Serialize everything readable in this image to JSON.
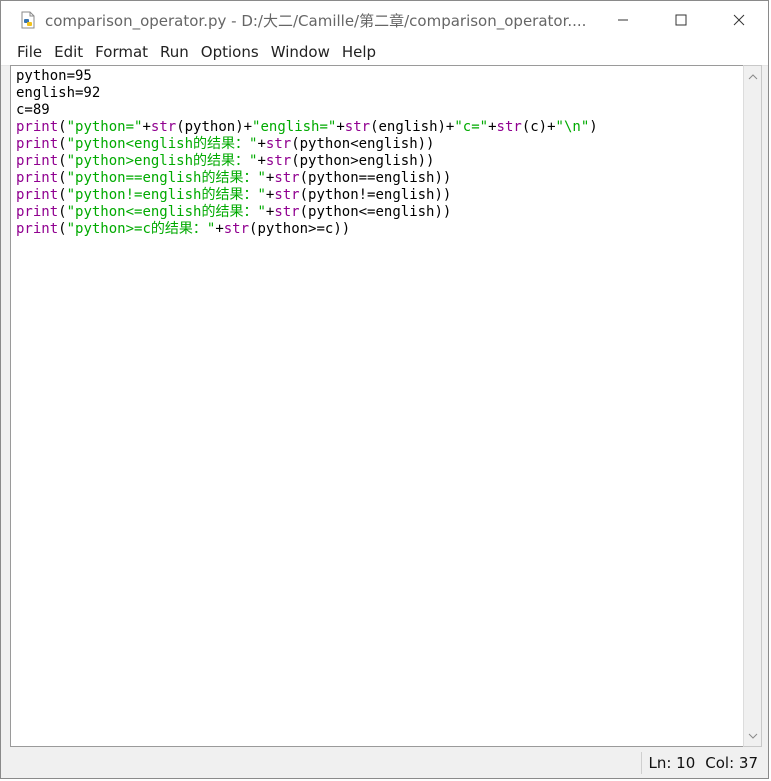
{
  "window": {
    "title": "comparison_operator.py - D:/大二/Camille/第二章/comparison_operator...."
  },
  "menu": {
    "items": [
      "File",
      "Edit",
      "Format",
      "Run",
      "Options",
      "Window",
      "Help"
    ]
  },
  "editor": {
    "lines": [
      [
        {
          "t": "python=95",
          "c": "plain"
        }
      ],
      [
        {
          "t": "english=92",
          "c": "plain"
        }
      ],
      [
        {
          "t": "c=89",
          "c": "plain"
        }
      ],
      [
        {
          "t": "print",
          "c": "kw"
        },
        {
          "t": "(",
          "c": "plain"
        },
        {
          "t": "\"python=\"",
          "c": "str"
        },
        {
          "t": "+",
          "c": "plain"
        },
        {
          "t": "str",
          "c": "kw"
        },
        {
          "t": "(python)+",
          "c": "plain"
        },
        {
          "t": "\"english=\"",
          "c": "str"
        },
        {
          "t": "+",
          "c": "plain"
        },
        {
          "t": "str",
          "c": "kw"
        },
        {
          "t": "(english)+",
          "c": "plain"
        },
        {
          "t": "\"c=\"",
          "c": "str"
        },
        {
          "t": "+",
          "c": "plain"
        },
        {
          "t": "str",
          "c": "kw"
        },
        {
          "t": "(c)+",
          "c": "plain"
        },
        {
          "t": "\"\\n\"",
          "c": "str"
        },
        {
          "t": ")",
          "c": "plain"
        }
      ],
      [
        {
          "t": "print",
          "c": "kw"
        },
        {
          "t": "(",
          "c": "plain"
        },
        {
          "t": "\"python<english的结果：\"",
          "c": "str"
        },
        {
          "t": "+",
          "c": "plain"
        },
        {
          "t": "str",
          "c": "kw"
        },
        {
          "t": "(python<english))",
          "c": "plain"
        }
      ],
      [
        {
          "t": "print",
          "c": "kw"
        },
        {
          "t": "(",
          "c": "plain"
        },
        {
          "t": "\"python>english的结果：\"",
          "c": "str"
        },
        {
          "t": "+",
          "c": "plain"
        },
        {
          "t": "str",
          "c": "kw"
        },
        {
          "t": "(python>english))",
          "c": "plain"
        }
      ],
      [
        {
          "t": "print",
          "c": "kw"
        },
        {
          "t": "(",
          "c": "plain"
        },
        {
          "t": "\"python==english的结果：\"",
          "c": "str"
        },
        {
          "t": "+",
          "c": "plain"
        },
        {
          "t": "str",
          "c": "kw"
        },
        {
          "t": "(python==english))",
          "c": "plain"
        }
      ],
      [
        {
          "t": "print",
          "c": "kw"
        },
        {
          "t": "(",
          "c": "plain"
        },
        {
          "t": "\"python!=english的结果：\"",
          "c": "str"
        },
        {
          "t": "+",
          "c": "plain"
        },
        {
          "t": "str",
          "c": "kw"
        },
        {
          "t": "(python!=english))",
          "c": "plain"
        }
      ],
      [
        {
          "t": "print",
          "c": "kw"
        },
        {
          "t": "(",
          "c": "plain"
        },
        {
          "t": "\"python<=english的结果：\"",
          "c": "str"
        },
        {
          "t": "+",
          "c": "plain"
        },
        {
          "t": "str",
          "c": "kw"
        },
        {
          "t": "(python<=english))",
          "c": "plain"
        }
      ],
      [
        {
          "t": "print",
          "c": "kw"
        },
        {
          "t": "(",
          "c": "plain"
        },
        {
          "t": "\"python>=c的结果：\"",
          "c": "str"
        },
        {
          "t": "+",
          "c": "plain"
        },
        {
          "t": "str",
          "c": "kw"
        },
        {
          "t": "(python>=c))",
          "c": "plain"
        }
      ]
    ]
  },
  "status": {
    "line": "Ln: 10",
    "col": "Col: 37"
  },
  "colors": {
    "keyword": "#900090",
    "string": "#00aa00",
    "plain": "#000000"
  },
  "icons": {
    "app": "python-file-icon",
    "minimize": "minimize-icon",
    "maximize": "maximize-icon",
    "close": "close-icon"
  }
}
